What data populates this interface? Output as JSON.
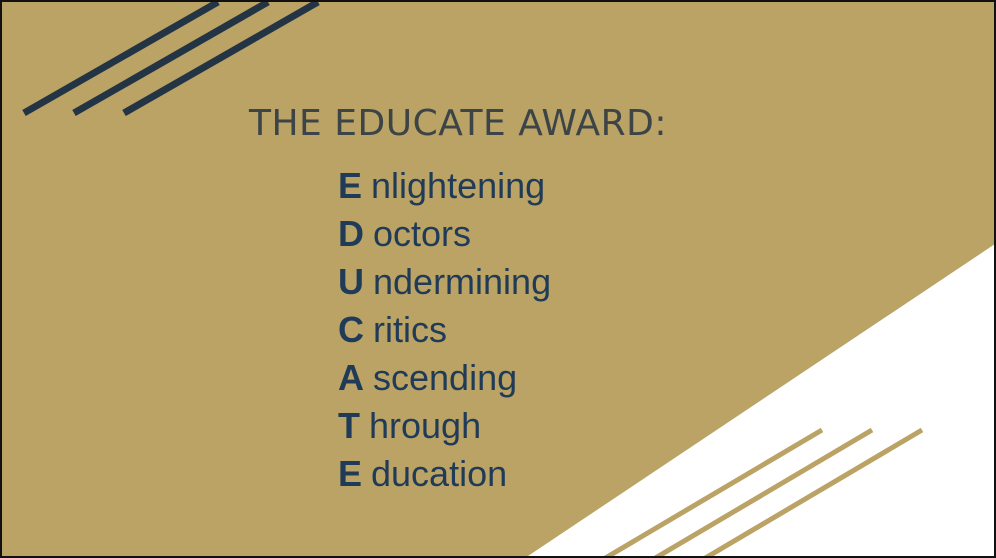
{
  "colors": {
    "gold": "#BBA265",
    "white": "#FFFFFF",
    "navy": "#1F3B57",
    "title_gray": "#3C4448",
    "stripe_dark": "#233544",
    "stripe_gold": "#BBA265"
  },
  "title": "THE EDUCATE  AWARD:",
  "acrostic": [
    {
      "letter": "E",
      "rest": "nlightening"
    },
    {
      "letter": "D",
      "rest": "octors"
    },
    {
      "letter": "U",
      "rest": "ndermining"
    },
    {
      "letter": "C",
      "rest": "ritics"
    },
    {
      "letter": "A",
      "rest": "scending"
    },
    {
      "letter": "T",
      "rest": "hrough"
    },
    {
      "letter": "E",
      "rest": "ducation"
    }
  ]
}
